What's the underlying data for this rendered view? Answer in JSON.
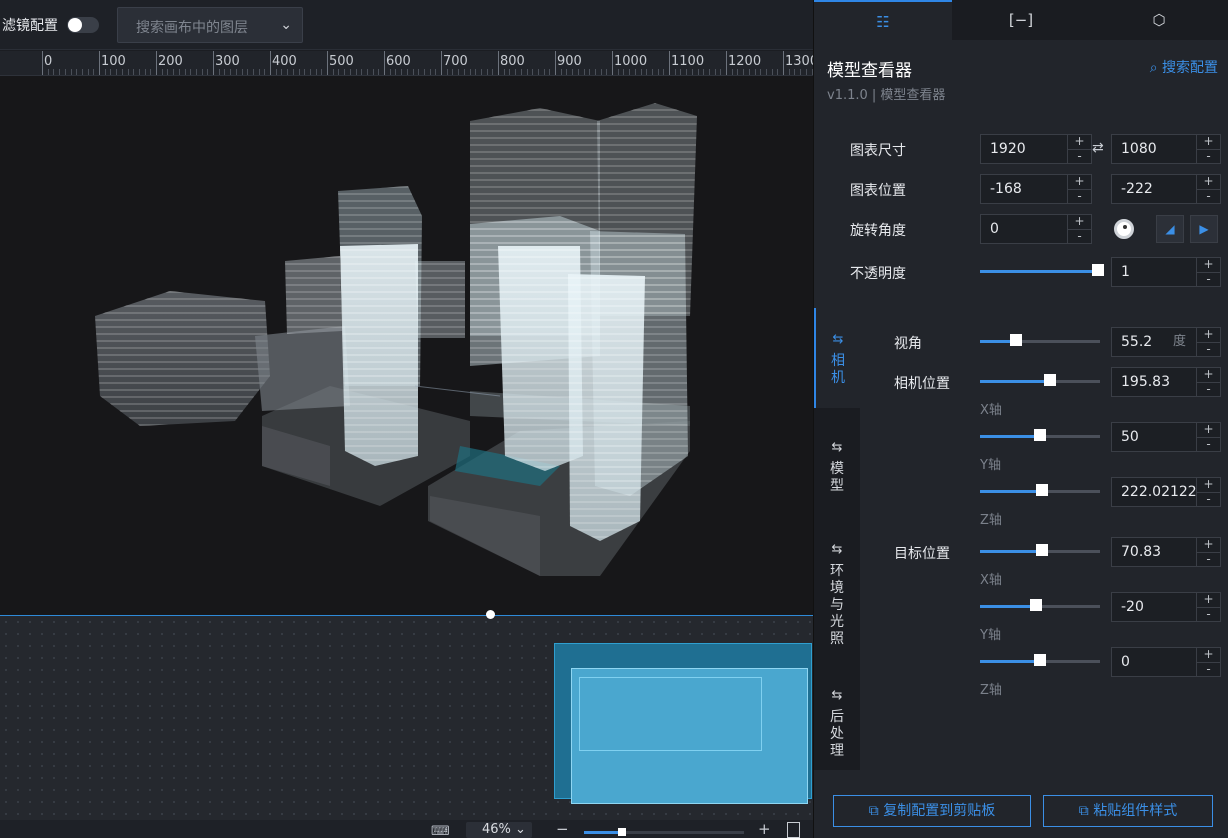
{
  "toolbar": {
    "filter_label": "滤镜配置",
    "layer_search_placeholder": "搜索画布中的图层"
  },
  "ruler": {
    "ticks": [
      "0",
      "100",
      "200",
      "300",
      "400",
      "500",
      "600",
      "700",
      "800",
      "900",
      "1000",
      "1100",
      "1200",
      "1300"
    ]
  },
  "status": {
    "zoom": "46%"
  },
  "panel": {
    "tabs": [
      "settings-icon",
      "bracket-icon",
      "cube-icon"
    ],
    "title": "模型查看器",
    "version": "v1.1.0 | 模型查看器",
    "search_config": "搜索配置",
    "chart_size_label": "图表尺寸",
    "width": "1920",
    "height": "1080",
    "chart_pos_label": "图表位置",
    "pos_x": "-168",
    "pos_y": "-222",
    "rotate_label": "旋转角度",
    "rotate": "0",
    "opacity_label": "不透明度",
    "opacity": "1",
    "opacity_level": 1.0,
    "vtabs": [
      "相机",
      "模型",
      "环境与光照",
      "后处理"
    ],
    "camera": {
      "fov_label": "视角",
      "fov": "55.2",
      "fov_unit": "度",
      "fov_level": 0.3,
      "cam_pos_label": "相机位置",
      "cam_x": "195.83",
      "cam_x_level": 0.58,
      "cam_y": "50",
      "cam_y_level": 0.5,
      "cam_z": "222.02122",
      "cam_z_level": 0.52,
      "target_label": "目标位置",
      "target_x": "70.83",
      "target_x_level": 0.52,
      "target_y": "-20",
      "target_y_level": 0.47,
      "target_z": "0",
      "target_z_level": 0.5,
      "x_axis": "X轴",
      "y_axis": "Y轴",
      "z_axis": "Z轴"
    },
    "copy_button": "复制配置到剪贴板",
    "paste_button": "粘贴组件样式"
  },
  "colors": {
    "accent": "#3b8fe6",
    "panel_bg": "#22252b",
    "canvas_bg": "#171719"
  }
}
